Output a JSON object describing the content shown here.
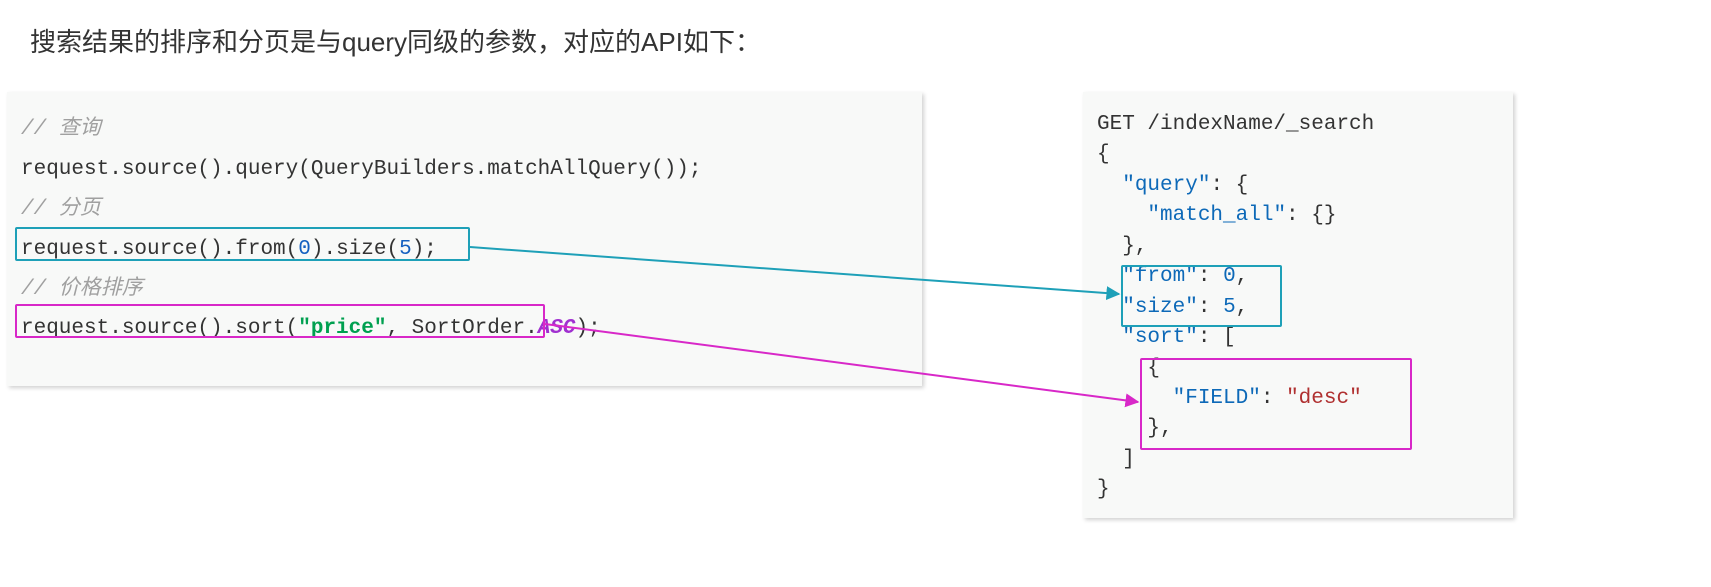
{
  "heading": "搜索结果的排序和分页是与query同级的参数，对应的API如下：",
  "left": {
    "comment_query": "// 查询",
    "line_query": "request.source().query(QueryBuilders.matchAllQuery());",
    "comment_page": "// 分页",
    "page_prefix": "request.source().from(",
    "page_from": "0",
    "page_mid": ").size(",
    "page_size": "5",
    "page_suffix": ");",
    "comment_sort": "// 价格排序",
    "sort_prefix": "request.source().sort(",
    "sort_field": "\"price\"",
    "sort_mid": ", SortOrder.",
    "sort_order": "ASC",
    "sort_suffix": ");"
  },
  "right": {
    "l1": "GET /indexName/_search",
    "l2": "{",
    "l3a": "  ",
    "l3b": "\"query\"",
    "l3c": ": {",
    "l4a": "    ",
    "l4b": "\"match_all\"",
    "l4c": ": {}",
    "l5": "  },",
    "l6a": "  ",
    "l6b": "\"from\"",
    "l6c": ": ",
    "l6d": "0",
    "l6e": ",",
    "l7a": "  ",
    "l7b": "\"size\"",
    "l7c": ": ",
    "l7d": "5",
    "l7e": ",",
    "l8a": "  ",
    "l8b": "\"sort\"",
    "l8c": ": [",
    "l9": "    {",
    "l10a": "      ",
    "l10b": "\"FIELD\"",
    "l10c": ": ",
    "l10d": "\"desc\"",
    "l11": "    },",
    "l12": "  ]",
    "l13": "}"
  },
  "colors": {
    "teal": "#1ea0b8",
    "magenta": "#d828c8"
  }
}
